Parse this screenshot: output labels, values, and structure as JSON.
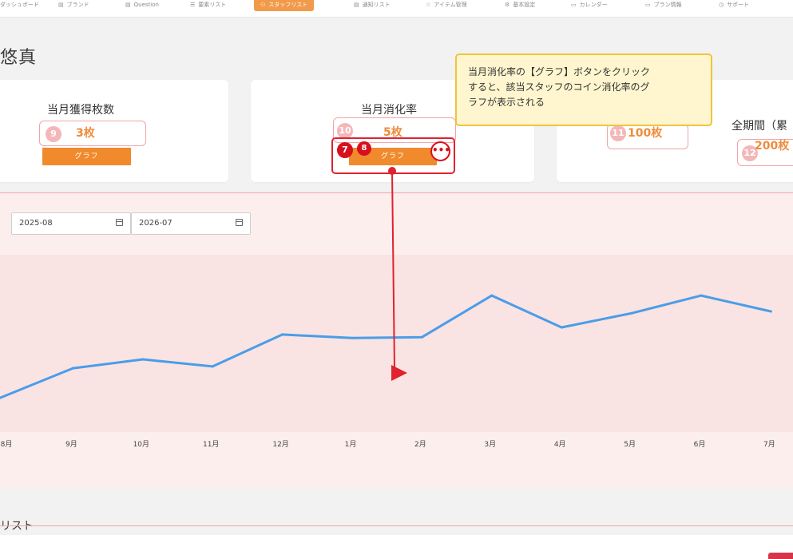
{
  "nav": {
    "items": [
      {
        "label": "ダッシュボード",
        "icon": "dashboard-icon",
        "glyph": ""
      },
      {
        "label": "ブランド",
        "icon": "document-icon",
        "glyph": "▤"
      },
      {
        "label": "Question",
        "icon": "document-icon",
        "glyph": "▤"
      },
      {
        "label": "要素リスト",
        "icon": "list-icon",
        "glyph": "☰"
      },
      {
        "label": "スタッフリスト",
        "icon": "users-icon",
        "glyph": "⚇",
        "active": true
      },
      {
        "label": "通知リスト",
        "icon": "document-icon",
        "glyph": "▤"
      },
      {
        "label": "アイテム管理",
        "icon": "star-icon",
        "glyph": "☆"
      },
      {
        "label": "基本設定",
        "icon": "gear-icon",
        "glyph": "⚙"
      },
      {
        "label": "カレンダー",
        "icon": "calendar-icon",
        "glyph": "▭"
      },
      {
        "label": "プラン情報",
        "icon": "card-icon",
        "glyph": "▭"
      },
      {
        "label": "サポート",
        "icon": "help-icon",
        "glyph": "◷"
      }
    ]
  },
  "page": {
    "title": "悠真"
  },
  "cards": {
    "acquired": {
      "label": "当月獲得枚数",
      "marker": "9",
      "value": "3枚",
      "button": "グラフ"
    },
    "consumption": {
      "label": "当月消化率",
      "marker": "10",
      "value": "5枚",
      "button": "グラフ"
    },
    "third": {
      "marker": "11",
      "value": "100枚"
    },
    "total": {
      "label": "全期間（累",
      "marker": "12",
      "value": "200枚"
    }
  },
  "annotation": {
    "step_a": "7",
    "step_b": "8",
    "more": "•••",
    "tooltip_lines": [
      "当月消化率の【グラフ】ボタンをクリック",
      "すると、該当スタッフのコイン消化率のグ",
      "ラフが表示される"
    ]
  },
  "filters": {
    "start": "2025-08",
    "end": "2026-07"
  },
  "chart_data": {
    "type": "line",
    "categories": [
      "8月",
      "9月",
      "10月",
      "11月",
      "12月",
      "1月",
      "2月",
      "3月",
      "4月",
      "5月",
      "6月",
      "7月"
    ],
    "values": [
      2.0,
      3.6,
      4.1,
      3.7,
      5.5,
      5.3,
      5.35,
      7.7,
      5.9,
      6.7,
      7.7,
      6.8
    ],
    "ylim": [
      0,
      10
    ],
    "color": "#4a9de8"
  },
  "sections": {
    "staff_list": "リスト"
  }
}
